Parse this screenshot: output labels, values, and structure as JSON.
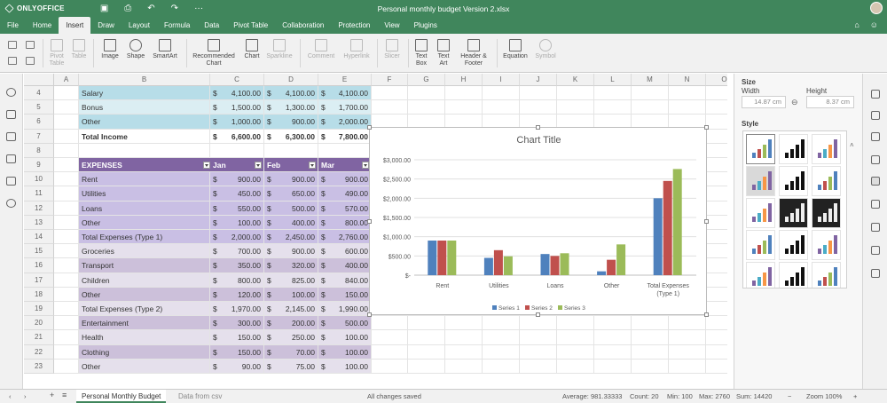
{
  "title_bar": {
    "app_name": "ONLYOFFICE",
    "document_title": "Personal monthly budget Version 2.xlsx"
  },
  "menu": {
    "tabs": [
      "File",
      "Home",
      "Insert",
      "Draw",
      "Layout",
      "Formula",
      "Data",
      "Pivot Table",
      "Collaboration",
      "Protection",
      "View",
      "Plugins"
    ],
    "active": "Insert"
  },
  "ribbon": {
    "pivot_table": "Pivot Table",
    "table": "Table",
    "image": "Image",
    "shape": "Shape",
    "smartart": "SmartArt",
    "recommended_chart": "Recommended Chart",
    "chart": "Chart",
    "sparkline": "Sparkline",
    "comment": "Comment",
    "hyperlink": "Hyperlink",
    "slicer": "Slicer",
    "text_box": "Text Box",
    "text_art": "Text Art",
    "header_footer": "Header & Footer",
    "equation": "Equation",
    "symbol": "Symbol"
  },
  "columns": [
    "A",
    "B",
    "C",
    "D",
    "E",
    "F",
    "G",
    "H",
    "I",
    "J",
    "K",
    "L",
    "M",
    "N",
    "O"
  ],
  "rows": [
    {
      "num": "4",
      "label": "Salary",
      "v1": "4,100.00",
      "v2": "4,100.00",
      "v3": "4,100.00",
      "style": "income"
    },
    {
      "num": "5",
      "label": "Bonus",
      "v1": "1,500.00",
      "v2": "1,300.00",
      "v3": "1,700.00",
      "style": "income-alt"
    },
    {
      "num": "6",
      "label": "Other",
      "v1": "1,000.00",
      "v2": "900.00",
      "v3": "2,000.00",
      "style": "income"
    },
    {
      "num": "7",
      "label": "Total Income",
      "v1": "6,600.00",
      "v2": "6,300.00",
      "v3": "7,800.00",
      "style": "total"
    },
    {
      "num": "8",
      "label": "",
      "v1": "",
      "v2": "",
      "v3": "",
      "style": "blank"
    },
    {
      "num": "9",
      "label": "EXPENSES",
      "v1": "Jan",
      "v2": "Feb",
      "v3": "Mar",
      "style": "header"
    },
    {
      "num": "10",
      "label": "Rent",
      "v1": "900.00",
      "v2": "900.00",
      "v3": "900.00",
      "style": "exp-sel"
    },
    {
      "num": "11",
      "label": "Utilities",
      "v1": "450.00",
      "v2": "650.00",
      "v3": "490.00",
      "style": "exp-sel"
    },
    {
      "num": "12",
      "label": "Loans",
      "v1": "550.00",
      "v2": "500.00",
      "v3": "570.00",
      "style": "exp-sel"
    },
    {
      "num": "13",
      "label": "Other",
      "v1": "100.00",
      "v2": "400.00",
      "v3": "800.00",
      "style": "exp-sel"
    },
    {
      "num": "14",
      "label": "Total Expenses (Type 1)",
      "v1": "2,000.00",
      "v2": "2,450.00",
      "v3": "2,760.00",
      "style": "exp-sel"
    },
    {
      "num": "15",
      "label": "Groceries",
      "v1": "700.00",
      "v2": "900.00",
      "v3": "600.00",
      "style": "exp"
    },
    {
      "num": "16",
      "label": "Transport",
      "v1": "350.00",
      "v2": "320.00",
      "v3": "400.00",
      "style": "exp-alt"
    },
    {
      "num": "17",
      "label": "Children",
      "v1": "800.00",
      "v2": "825.00",
      "v3": "840.00",
      "style": "exp"
    },
    {
      "num": "18",
      "label": "Other",
      "v1": "120.00",
      "v2": "100.00",
      "v3": "150.00",
      "style": "exp-alt"
    },
    {
      "num": "19",
      "label": "Total Expenses (Type 2)",
      "v1": "1,970.00",
      "v2": "2,145.00",
      "v3": "1,990.00",
      "style": "exp"
    },
    {
      "num": "20",
      "label": "Entertainment",
      "v1": "300.00",
      "v2": "200.00",
      "v3": "500.00",
      "style": "exp-alt"
    },
    {
      "num": "21",
      "label": "Health",
      "v1": "150.00",
      "v2": "250.00",
      "v3": "100.00",
      "style": "exp"
    },
    {
      "num": "22",
      "label": "Clothing",
      "v1": "150.00",
      "v2": "70.00",
      "v3": "100.00",
      "style": "exp-alt"
    },
    {
      "num": "23",
      "label": "Other",
      "v1": "90.00",
      "v2": "75.00",
      "v3": "100.00",
      "style": "exp"
    }
  ],
  "currency_symbol": "$",
  "chart_data": {
    "type": "bar",
    "title": "Chart Title",
    "categories": [
      "Rent",
      "Utilities",
      "Loans",
      "Other",
      "Total Expenses (Type 1)"
    ],
    "series": [
      {
        "name": "Series 1",
        "values": [
          900,
          450,
          550,
          100,
          2000
        ],
        "color": "#4f81bd"
      },
      {
        "name": "Series 2",
        "values": [
          900,
          650,
          500,
          400,
          2450
        ],
        "color": "#c0504d"
      },
      {
        "name": "Series 3",
        "values": [
          900,
          490,
          570,
          800,
          2760
        ],
        "color": "#9bbb59"
      }
    ],
    "y_ticks": [
      "$3,000.00",
      "$2,500.00",
      "$2,000.00",
      "$1,500.00",
      "$1,000.00",
      "$500.00",
      "$-"
    ],
    "ylim": [
      0,
      3000
    ],
    "legend": "bottom",
    "grid": true
  },
  "right_panel": {
    "size_label": "Size",
    "width_label": "Width",
    "height_label": "Height",
    "width_value": "14.87 cm",
    "height_value": "8.37 cm",
    "style_label": "Style"
  },
  "status_bar": {
    "sheets": [
      "Personal Monthly Budget",
      "Data from csv"
    ],
    "save_status": "All changes saved",
    "average": "Average: 981.33333",
    "count": "Count: 20",
    "min": "Min: 100",
    "max": "Max: 2760",
    "sum": "Sum: 14420",
    "zoom": "Zoom 100%"
  },
  "colors": {
    "brand": "#40865c",
    "income": "#b7dde8",
    "income_alt": "#dbeef3",
    "expense_header": "#8064a2",
    "expense": "#e5e0ec",
    "expense_alt": "#ccc0da",
    "selection": "#c9bfe4"
  }
}
